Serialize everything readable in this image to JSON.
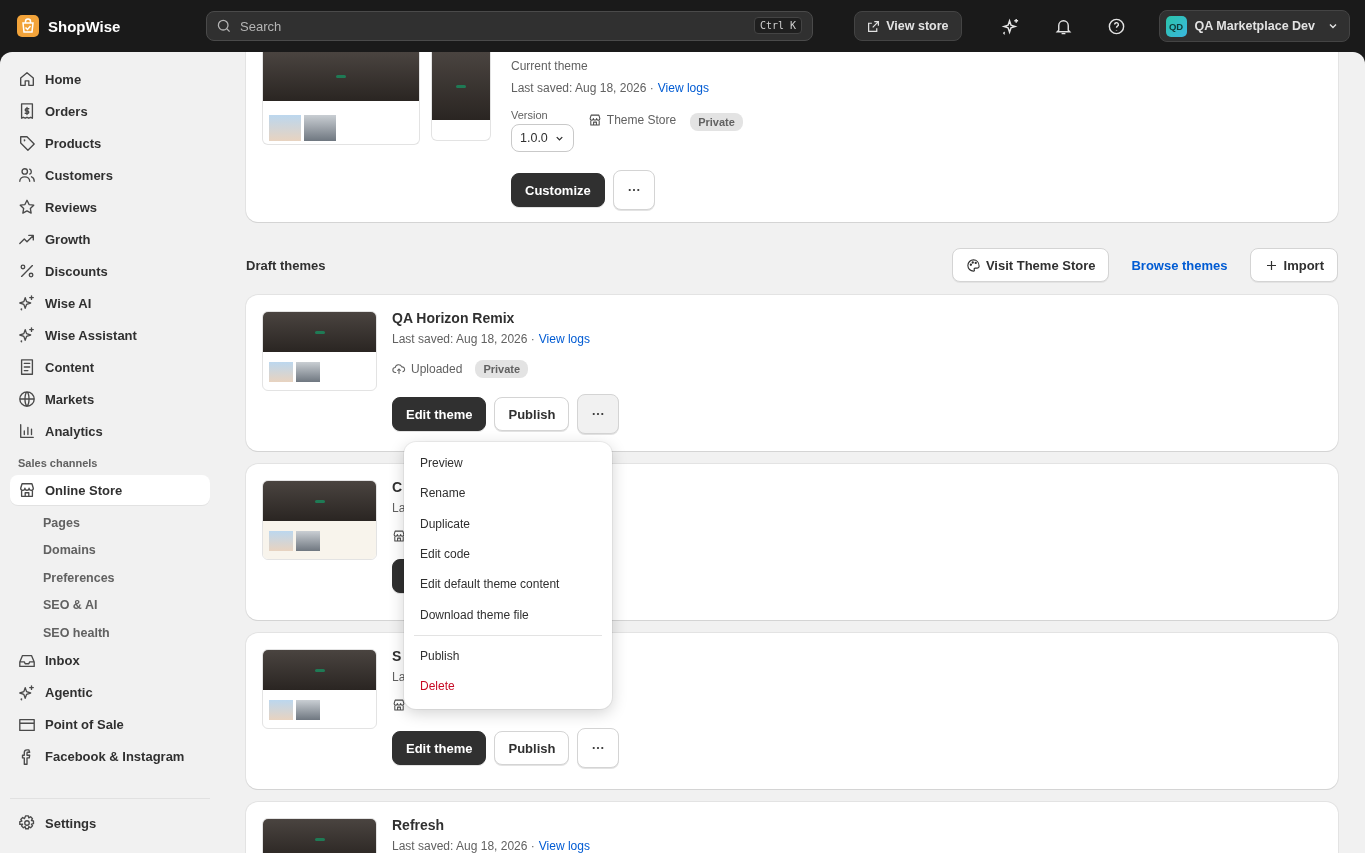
{
  "topbar": {
    "brand": "ShopWise",
    "search": {
      "placeholder": "Search"
    },
    "shortcut": "Ctrl K",
    "view_store": "View store",
    "account": {
      "initials": "QD",
      "name": "QA Marketplace Dev"
    }
  },
  "sidebar": {
    "items": [
      {
        "label": "Home",
        "selected": false
      },
      {
        "label": "Orders",
        "selected": false
      },
      {
        "label": "Products",
        "selected": false
      },
      {
        "label": "Customers",
        "selected": false
      },
      {
        "label": "Reviews",
        "selected": false
      },
      {
        "label": "Growth",
        "selected": false
      },
      {
        "label": "Discounts",
        "selected": false
      },
      {
        "label": "Wise AI",
        "selected": false
      },
      {
        "label": "Wise Assistant",
        "selected": false
      },
      {
        "label": "Content",
        "selected": false
      },
      {
        "label": "Markets",
        "selected": false
      },
      {
        "label": "Analytics",
        "selected": false
      }
    ],
    "section": "Sales channels",
    "channels": [
      {
        "label": "Online Store",
        "selected": true,
        "children": [
          {
            "label": "Pages"
          },
          {
            "label": "Domains"
          },
          {
            "label": "Preferences"
          },
          {
            "label": "SEO & AI"
          },
          {
            "label": "SEO health"
          }
        ]
      },
      {
        "label": "Inbox",
        "selected": false
      },
      {
        "label": "Agentic",
        "selected": false
      },
      {
        "label": "Point of Sale",
        "selected": false
      },
      {
        "label": "Facebook & Instagram",
        "selected": false
      }
    ],
    "settings": "Settings"
  },
  "current_theme": {
    "status": "Current theme",
    "saved": "Last saved: Aug 18, 2026 ·",
    "link": "View logs",
    "version_label": "Version",
    "version": "1.0.0",
    "source": "Theme Store",
    "badge": "Private",
    "customize": "Customize"
  },
  "drafts": {
    "heading": "Draft themes",
    "visit": "Visit Theme Store",
    "browse": "Browse themes",
    "import": "Import"
  },
  "themes": [
    {
      "name": "QA Horizon Remix",
      "saved": "Last saved: Aug 18, 2026 ·",
      "link": "View logs",
      "source": {
        "kind": "uploaded",
        "label": "Uploaded"
      },
      "badge": "Private",
      "buttons": {
        "kind": "full",
        "edit": "Edit theme",
        "publish": "Publish"
      },
      "menu": [
        {
          "label": "Preview",
          "kind": "normal"
        },
        {
          "label": "Rename",
          "kind": "normal"
        },
        {
          "label": "Duplicate",
          "kind": "normal"
        },
        {
          "label": "Edit code",
          "kind": "normal"
        },
        {
          "label": "Edit default theme content",
          "kind": "normal"
        },
        {
          "label": "Download theme file",
          "kind": "normal"
        },
        {
          "label": "Publish",
          "kind": "separated"
        },
        {
          "label": "Delete",
          "kind": "danger"
        }
      ]
    },
    {
      "name": "C",
      "saved": "La",
      "source": {
        "kind": "store"
      },
      "buttons": {
        "kind": "clipped"
      }
    },
    {
      "name": "S",
      "saved": "La",
      "source": {
        "kind": "store"
      },
      "buttons": {
        "kind": "full",
        "edit": "Edit theme",
        "publish": "Publish"
      }
    },
    {
      "name": "Refresh",
      "saved": "Last saved: Aug 18, 2026 ·",
      "link": "View logs"
    }
  ]
}
